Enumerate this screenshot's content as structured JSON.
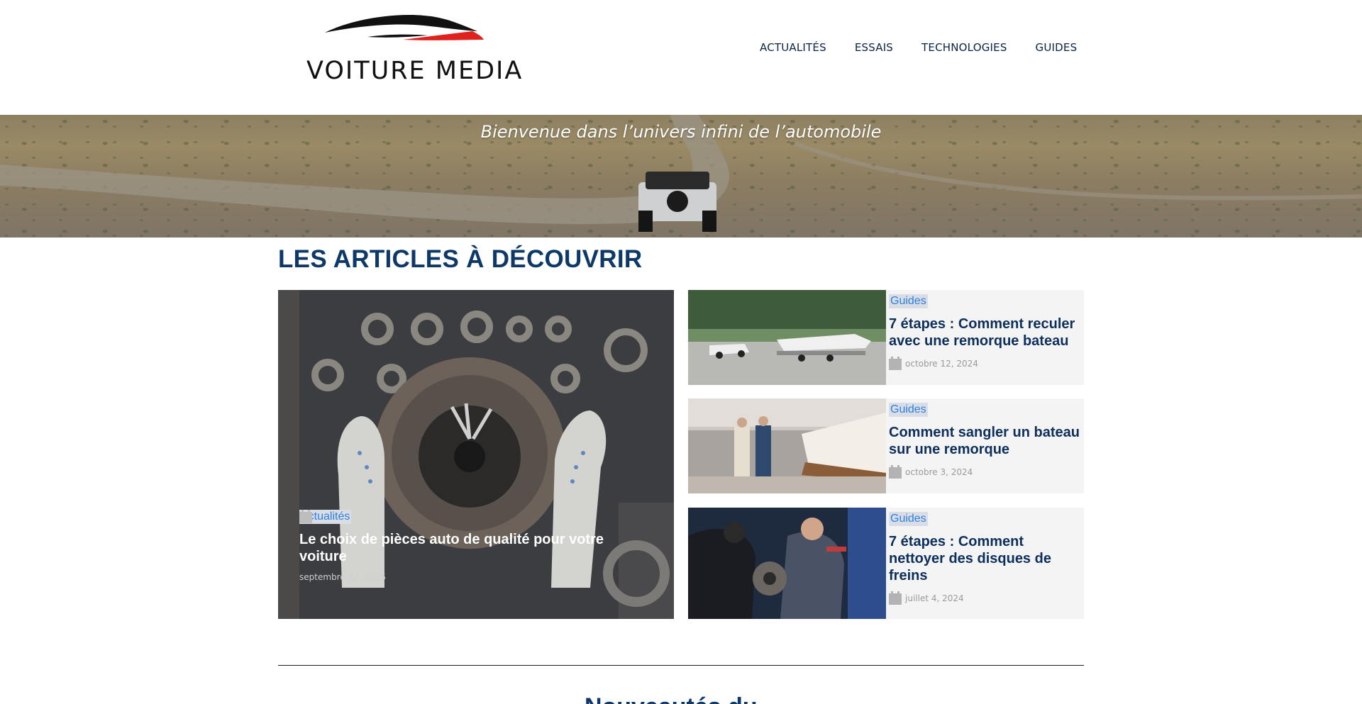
{
  "header": {
    "logo_text": "VOITURE MEDIA",
    "nav": [
      "ACTUALITÉS",
      "ESSAIS",
      "TECHNOLOGIES",
      "GUIDES"
    ]
  },
  "hero": {
    "tagline": "Bienvenue dans l’univers infini de l’automobile"
  },
  "section": {
    "title": "LES ARTICLES À DÉCOUVRIR"
  },
  "featured": {
    "category": "Actualités",
    "title": "Le choix de pièces auto de qualité pour votre voiture",
    "date": "septembre 22, 2025",
    "icon": "calendar-icon"
  },
  "cards": [
    {
      "category": "Guides",
      "title": "7 étapes : Comment reculer avec une remorque bateau",
      "date": "octobre 12, 2024",
      "icon": "calendar-icon"
    },
    {
      "category": "Guides",
      "title": "Comment sangler un bateau sur une remorque",
      "date": "octobre 3, 2024",
      "icon": "calendar-icon"
    },
    {
      "category": "Guides",
      "title": "7 étapes : Comment nettoyer des disques de freins",
      "date": "juillet 4, 2024",
      "icon": "calendar-icon"
    }
  ],
  "next_section": {
    "title": "Nouveautés du..."
  },
  "colors": {
    "title_blue": "#0d3867",
    "tag_text": "#2f7fe0",
    "tag_bg": "#d8dde6",
    "logo_red": "#e0221e",
    "card_bg": "#f4f4f4"
  }
}
